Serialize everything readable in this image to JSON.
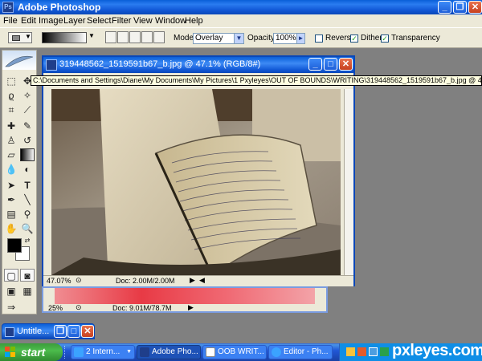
{
  "app": {
    "title": "Adobe Photoshop"
  },
  "menu": {
    "items": [
      "File",
      "Edit",
      "Image",
      "Layer",
      "Select",
      "Filter",
      "View",
      "Window",
      "Help"
    ]
  },
  "options": {
    "mode_label": "Mode:",
    "mode_value": "Overlay",
    "opacity_label": "Opacity:",
    "opacity_value": "100%",
    "reverse_label": "Reverse",
    "reverse_checked": false,
    "dither_label": "Dither",
    "dither_checked": true,
    "transparency_label": "Transparency",
    "transparency_checked": true
  },
  "document": {
    "title": "319448562_1519591b67_b.jpg @ 47.1% (RGB/8#)",
    "zoom": "47.07%",
    "doc_size": "Doc: 2.00M/2.00M"
  },
  "path_tooltip": "C:\\Documents and Settings\\Diane\\My Documents\\My Pictures\\1 Pxyleyes\\OUT OF BOUNDS\\WRITING\\319448562_1519591b67_b.jpg @ 47.1% (RGB/8#)",
  "document2": {
    "zoom": "25%",
    "doc_size": "Doc: 9.01M/78.7M"
  },
  "untitled": {
    "title": "Untitle..."
  },
  "taskbar": {
    "start_label": "start",
    "items": [
      {
        "label": "2 Intern...",
        "active": false
      },
      {
        "label": "Adobe Pho...",
        "active": true
      },
      {
        "label": "OOB WRIT...",
        "active": false
      },
      {
        "label": "Editor - Ph...",
        "active": false
      }
    ]
  },
  "watermark": "pxleyes.com",
  "colors": {
    "xp_blue": "#0a5fd8",
    "taskbar_green": "#3c9c3c",
    "window_bg": "#ece9d8"
  }
}
